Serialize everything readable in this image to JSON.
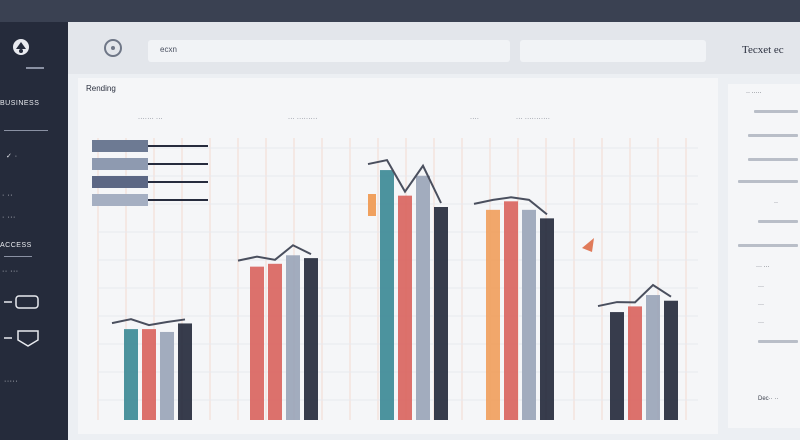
{
  "sidebar": {
    "items": [
      {
        "label": "BUSINESS"
      },
      {
        "label": "✓  ·"
      },
      {
        "label": "·  ··"
      },
      {
        "label": "·  ···"
      },
      {
        "label": "ACCESS"
      },
      {
        "label": "·· ···"
      }
    ],
    "footer_label": "·····"
  },
  "header": {
    "search_value": "ecxn",
    "title": "Tecxet  ec"
  },
  "panel": {
    "title": "Rending",
    "col_heads": [
      "·······  ···",
      "···  ·········",
      "····",
      "···  ···········"
    ]
  },
  "right_panel": {
    "top_label": "·· ·····",
    "mid_label": "··",
    "labels": [
      "··· ···",
      "···",
      "···",
      "···",
      "Dec·· ··"
    ]
  },
  "colors": {
    "teal": "#3d8a96",
    "coral": "#d9655f",
    "orange": "#f0a05e",
    "slate": "#9aa5b8",
    "navy": "#262b3d",
    "accent": "#f0a05e"
  },
  "chart_data": {
    "type": "bar",
    "title": "",
    "groups": [
      {
        "values": [
          0.32,
          0.32,
          0.31,
          0.34
        ],
        "colors": [
          "teal",
          "coral",
          "slate",
          "navy"
        ]
      },
      {
        "values": [
          0.54,
          0.55,
          0.58,
          0.57
        ],
        "colors": [
          "coral",
          "coral",
          "slate",
          "navy"
        ]
      },
      {
        "values": [
          0.88,
          0.79,
          0.86,
          0.75
        ],
        "colors": [
          "teal",
          "coral",
          "slate",
          "navy"
        ]
      },
      {
        "values": [
          0.74,
          0.77,
          0.74,
          0.71
        ],
        "colors": [
          "orange",
          "coral",
          "slate",
          "navy"
        ]
      },
      {
        "values": [
          0.38,
          0.4,
          0.44,
          0.42
        ],
        "colors": [
          "navy",
          "coral",
          "slate",
          "navy"
        ]
      }
    ],
    "ylim": [
      0,
      1
    ],
    "grid": true
  }
}
